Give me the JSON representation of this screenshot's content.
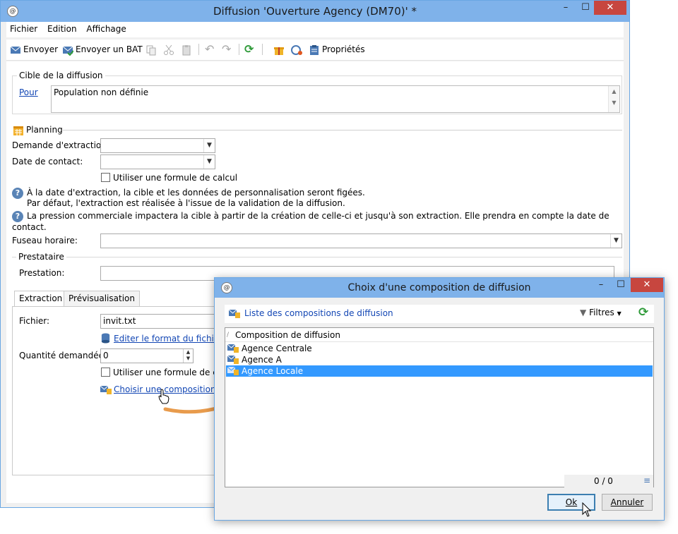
{
  "main_window": {
    "title": "Diffusion 'Ouverture Agency (DM70)' *",
    "controls": {
      "minimize": "–",
      "maximize": "☐",
      "close": "✕"
    },
    "menu": [
      "Fichier",
      "Edition",
      "Affichage"
    ],
    "toolbar": {
      "send": "Envoyer",
      "send_proof": "Envoyer un BAT",
      "properties": "Propriétés",
      "icons": [
        "envelope-icon",
        "envelope-check-icon",
        "copy-icon",
        "cut-icon",
        "paste-icon",
        "undo-icon",
        "redo-icon",
        "refresh-icon",
        "gift-icon",
        "ruler-icon",
        "clipboard-icon"
      ]
    },
    "target": {
      "group_title": "Cible de la diffusion",
      "for_link": "Pour",
      "population": "Population non définie"
    },
    "planning": {
      "title": "Planning",
      "extraction_label": "Demande d'extraction:",
      "contact_label": "Date de contact:",
      "formula_checkbox": "Utiliser une formule de calcul",
      "help1_line1": "À la date d'extraction, la cible et les données de personnalisation seront figées.",
      "help1_line2": "Par défaut, l'extraction est réalisée à l'issue de la validation de la diffusion.",
      "help2": "La pression commerciale impactera la cible à partir de la création de celle-ci et jusqu'à son extraction. Elle prendra en compte la date de contact.",
      "timezone_label": "Fuseau horaire:"
    },
    "provider": {
      "group_title": "Prestataire",
      "service_label": "Prestation:"
    },
    "tabs": [
      "Extraction",
      "Prévisualisation"
    ],
    "extraction": {
      "file_label": "Fichier:",
      "file_value": "invit.txt",
      "edit_format_link": "Editer le format du fichier d",
      "quantity_label": "Quantité demandée:",
      "quantity_value": "0",
      "formula_checkbox": "Utiliser une formule de calc",
      "choose_composition_link": "Choisir une composition de"
    }
  },
  "dialog": {
    "title": "Choix d'une composition de diffusion",
    "controls": {
      "minimize": "–",
      "maximize": "☐",
      "close": "✕"
    },
    "list_title": "Liste des compositions de diffusion",
    "filters": "Filtres",
    "column_header": "Composition de diffusion",
    "rows": [
      "Agence Centrale",
      "Agence A",
      "Agence Locale"
    ],
    "selected_index": 2,
    "count": "0 / 0",
    "ok": "Ok",
    "cancel": "Annuler"
  },
  "colors": {
    "titlebar": "#7fb2ea",
    "selection": "#3399ff",
    "link": "#1246b4",
    "arrow": "#e89b4c",
    "close": "#c7463f"
  }
}
